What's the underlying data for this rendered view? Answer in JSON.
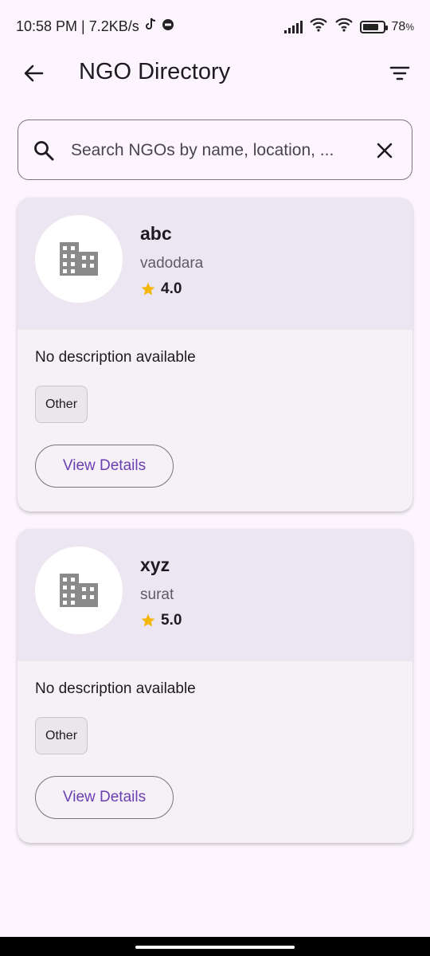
{
  "status_bar": {
    "time_speed": "10:58 PM | 7.2KB/s",
    "battery_percent": "78",
    "battery_suffix": "%",
    "battery_level": 0.78
  },
  "app_bar": {
    "title": "NGO Directory",
    "back_icon": "arrow-back-icon",
    "filter_icon": "filter-list-icon"
  },
  "search": {
    "placeholder": "Search NGOs by name, location, ...",
    "value": ""
  },
  "colors": {
    "background": "#fcf5fd",
    "card_header": "#ece6f3",
    "accent": "#6a3fb0",
    "star": "#f5b50a"
  },
  "ngos": [
    {
      "name": "abc",
      "location": "vadodara",
      "rating": "4.0",
      "description": "No description available",
      "category": "Other",
      "button_label": "View Details"
    },
    {
      "name": "xyz",
      "location": "surat",
      "rating": "5.0",
      "description": "No description available",
      "category": "Other",
      "button_label": "View Details"
    }
  ]
}
